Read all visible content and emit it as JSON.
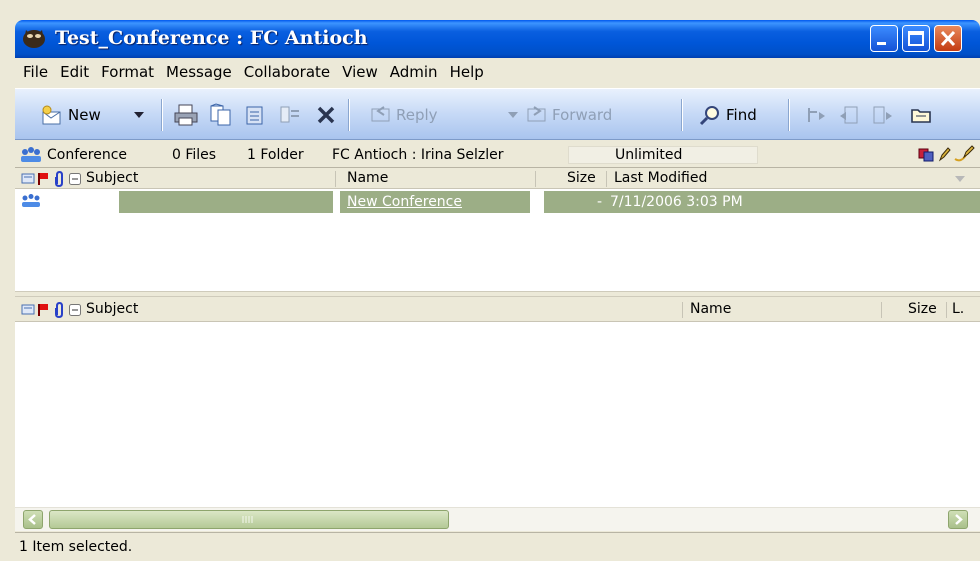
{
  "window": {
    "title": "Test_Conference : FC Antioch",
    "controls": [
      "minimize-icon",
      "maximize-icon",
      "close-icon"
    ]
  },
  "menu": [
    "File",
    "Edit",
    "Format",
    "Message",
    "Collaborate",
    "View",
    "Admin",
    "Help"
  ],
  "toolbar": {
    "new_label": "New",
    "reply_label": "Reply",
    "forward_label": "Forward",
    "find_label": "Find"
  },
  "info": {
    "type_label": "Conference",
    "files": "0 Files",
    "folders": "1 Folder",
    "location": "FC Antioch : Irina Selzler",
    "storage": "Unlimited"
  },
  "folder_columns": {
    "subject": "Subject",
    "name": "Name",
    "size": "Size",
    "modified": "Last Modified"
  },
  "folder_rows": [
    {
      "name": "New Conference",
      "size": "-",
      "modified": "7/11/2006  3:03 PM",
      "selected": true
    }
  ],
  "message_columns": {
    "subject": "Subject",
    "name": "Name",
    "size": "Size",
    "l": "L."
  },
  "status": "1 Item selected.",
  "colors": {
    "title_bar": "#0a5fe0",
    "selection": "#9cae86",
    "toolbar": "#c6d9f6"
  }
}
